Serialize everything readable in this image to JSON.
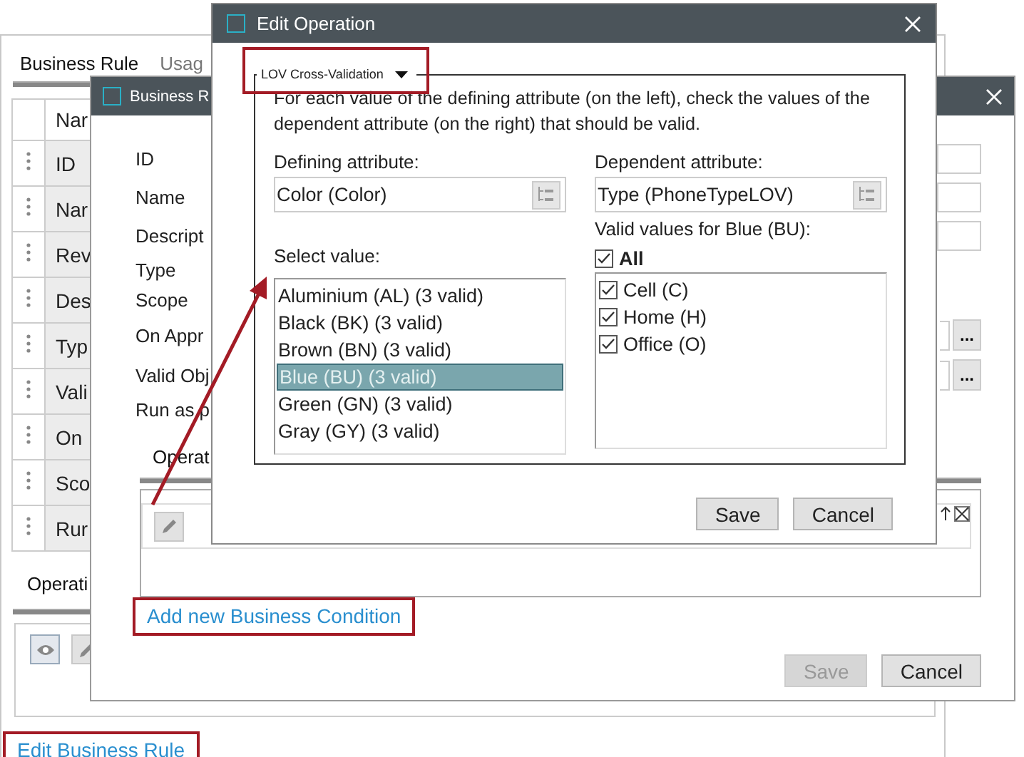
{
  "main_window": {
    "tabs": [
      {
        "label": "Business Rule",
        "selected": true
      },
      {
        "label": "Usag",
        "selected": false
      }
    ],
    "table": {
      "columns": [
        "Nar"
      ],
      "rows": [
        [
          "ID"
        ],
        [
          "Nar"
        ],
        [
          "Rev"
        ],
        [
          "Des"
        ],
        [
          "Typ"
        ],
        [
          "Vali"
        ],
        [
          "On"
        ],
        [
          "Sco"
        ],
        [
          "Rur"
        ]
      ]
    },
    "bottom_tabs": [
      {
        "label": "Operati",
        "selected": true
      }
    ],
    "link": "Edit Business Rule"
  },
  "business_rule_dialog": {
    "title": "Business R",
    "fields": [
      {
        "label": "ID",
        "kind": "text"
      },
      {
        "label": "Name",
        "kind": "text"
      },
      {
        "label": "Descript",
        "kind": "text"
      },
      {
        "label": "Type",
        "kind": "plain"
      },
      {
        "label": "Scope",
        "kind": "plain"
      },
      {
        "label": "On Appr",
        "kind": "picker",
        "button": "..."
      },
      {
        "label": "Valid Obj",
        "kind": "picker",
        "button": "..."
      },
      {
        "label": "Run as p",
        "kind": "plain"
      }
    ],
    "tabs": [
      {
        "label": "Operat",
        "selected": true
      }
    ],
    "link": "Add new Business Condition",
    "buttons": [
      {
        "label": "Save",
        "disabled": true
      },
      {
        "label": "Cancel",
        "disabled": false
      }
    ]
  },
  "edit_operation_dialog": {
    "title": "Edit Operation",
    "operation_type": "LOV Cross-Validation",
    "description": "For each value of the defining attribute (on the left), check the values of the dependent attribute (on the right) that should be valid.",
    "defining_attribute": {
      "label": "Defining attribute:",
      "value": "Color (Color)"
    },
    "dependent_attribute": {
      "label": "Dependent attribute:",
      "value": "Type (PhoneTypeLOV)"
    },
    "select_value": {
      "label": "Select value:",
      "items": [
        {
          "text": "Aluminium (AL) (3 valid)",
          "selected": false
        },
        {
          "text": "Black (BK) (3 valid)",
          "selected": false
        },
        {
          "text": "Brown (BN) (3 valid)",
          "selected": false
        },
        {
          "text": "Blue (BU) (3 valid)",
          "selected": true
        },
        {
          "text": "Green (GN) (3 valid)",
          "selected": false
        },
        {
          "text": "Gray (GY) (3 valid)",
          "selected": false
        }
      ]
    },
    "valid_values": {
      "label": "Valid values for Blue (BU):",
      "all": {
        "label": "All",
        "checked": true
      },
      "items": [
        {
          "text": "Cell (C)",
          "checked": true
        },
        {
          "text": "Home (H)",
          "checked": true
        },
        {
          "text": "Office (O)",
          "checked": true
        }
      ]
    },
    "buttons": [
      {
        "label": "Save",
        "disabled": false
      },
      {
        "label": "Cancel",
        "disabled": false
      }
    ]
  }
}
